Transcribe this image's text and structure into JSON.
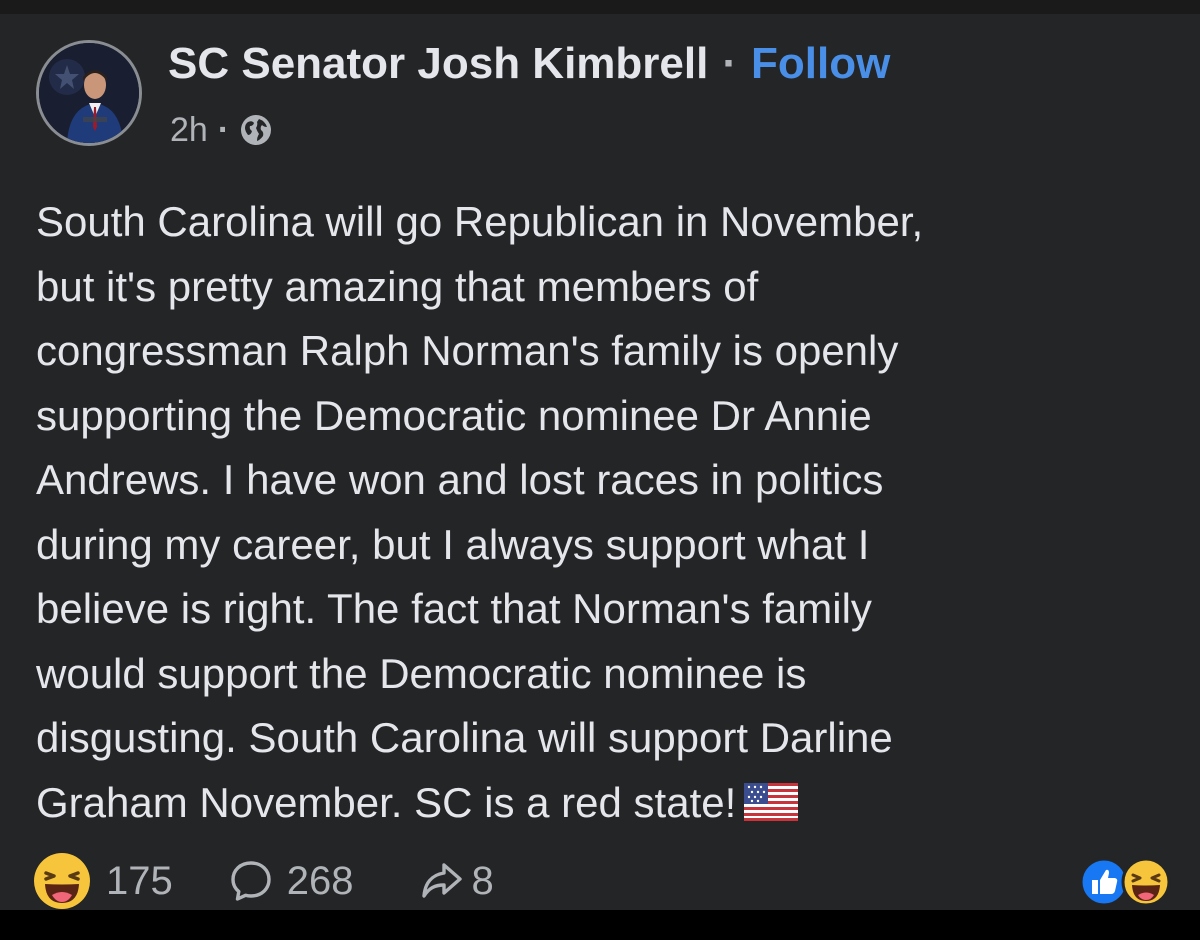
{
  "post": {
    "author_name": "SC Senator Josh Kimbrell",
    "separator": "·",
    "follow_label": "Follow",
    "timestamp": "2h",
    "meta_separator": "·",
    "privacy_icon": "globe-icon",
    "text_lines": [
      "South Carolina will go Republican in November,",
      "but it's pretty amazing that members of",
      "congressman Ralph Norman's family is openly",
      "supporting the Democratic nominee Dr Annie",
      "Andrews. I have won and lost races in politics",
      "during my career, but I always support what I",
      "believe is right. The fact that Norman's family",
      "would support the Democratic nominee is",
      "disgusting. South Carolina will support Darline",
      "Graham November. SC is a red state!"
    ],
    "trailing_emoji": "us-flag-icon"
  },
  "footer": {
    "reactions_icon": "haha-icon",
    "reactions_count": "175",
    "comments_icon": "comment-icon",
    "comments_count": "268",
    "shares_icon": "share-icon",
    "shares_count": "8",
    "reaction_summary_icons": [
      "like-icon",
      "haha-icon"
    ]
  },
  "colors": {
    "card_background": "#242526",
    "text": "#e4e6eb",
    "secondary_text": "#b0b3b8",
    "follow_blue": "#4a8fe7",
    "like_blue": "#1877f2",
    "haha_yellow": "#f7c53b"
  }
}
